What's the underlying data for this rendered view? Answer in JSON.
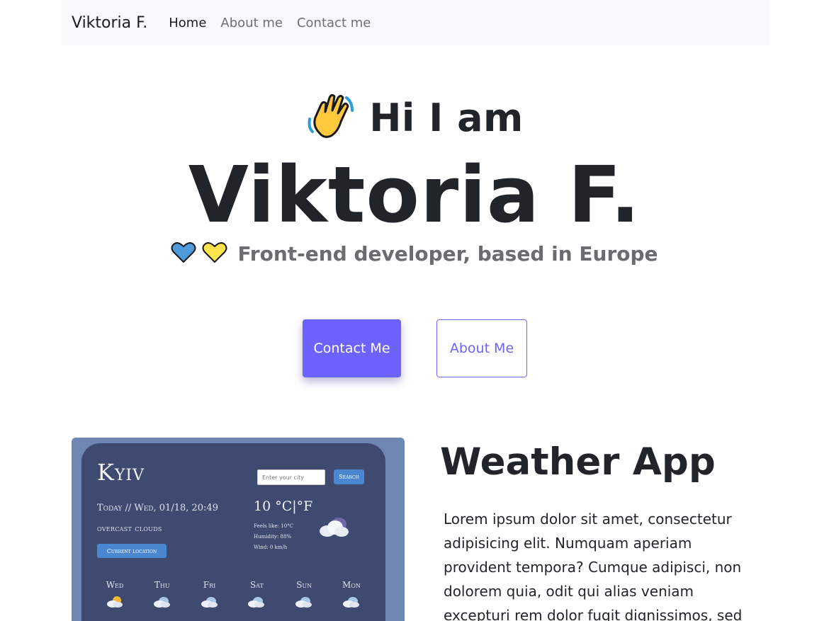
{
  "nav": {
    "brand": "Viktoria F.",
    "links": [
      "Home",
      "About me",
      "Contact me"
    ]
  },
  "hero": {
    "greeting": "Hi I am",
    "name": "Viktoria F.",
    "subtitle": "Front-end developer, based in Europe",
    "contact_button": "Contact Me",
    "about_button": "About Me"
  },
  "weather_app": {
    "city": "Kyiv",
    "search_placeholder": "Enter your city",
    "search_button": "Search",
    "date": "Today // Wed, 01/18, 20:49",
    "condition": "overcast clouds",
    "current_location_button": "Current location",
    "temperature": "10 °C|°F",
    "feels_like": "Feels like: 10°C",
    "humidity": "Humidity: 88%",
    "wind": "Wind: 0 km/h",
    "forecast_days": [
      "Wed",
      "Thu",
      "Fri",
      "Sat",
      "Sun",
      "Mon"
    ]
  },
  "project": {
    "title": "Weather App",
    "description": "Lorem ipsum dolor sit amet, consectetur adipisicing elit. Numquam aperiam provident tempora? Cumque adipisci, non dolorem quia, odit qui alias veniam excepturi rem dolor fugit dignissimos, sed"
  },
  "colors": {
    "accent": "#6c63ff",
    "navbar_bg": "#f8f9fa",
    "app_frame": "#6f86b3",
    "app_bg": "#3e4a6f",
    "app_button": "#4a87d0"
  }
}
